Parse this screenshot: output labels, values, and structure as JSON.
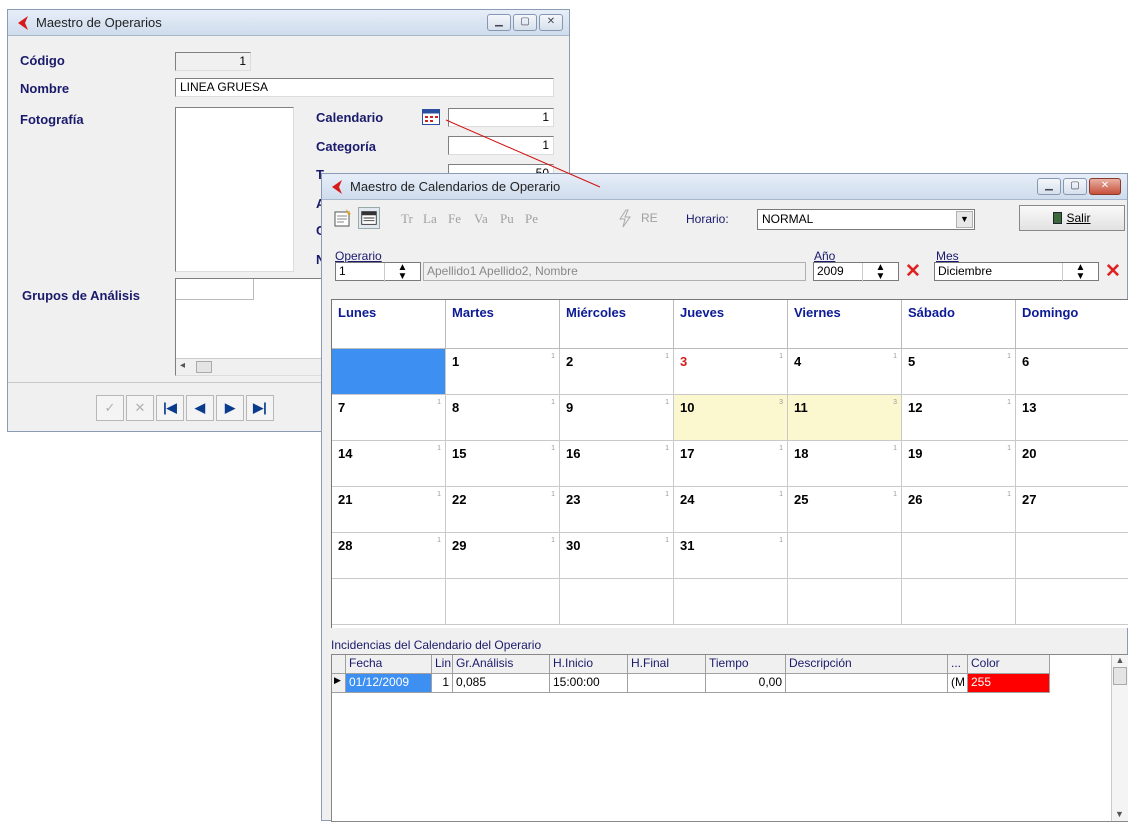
{
  "operarios": {
    "title": "Maestro de Operarios",
    "labels": {
      "codigo": "Código",
      "nombre": "Nombre",
      "fotografia": "Fotografía",
      "calendario": "Calendario",
      "categoria": "Categoría",
      "tarifa": "T",
      "a": "A",
      "c": "C",
      "n": "N",
      "grupos": "Grupos de Análisis"
    },
    "values": {
      "codigo": "1",
      "nombre": "LINEA GRUESA",
      "calendario": "1",
      "categoria": "1",
      "tarifa_partial": "50"
    },
    "nav": [
      "✓",
      "✕",
      "|◀",
      "◀",
      "▶",
      "▶|"
    ]
  },
  "calendarios": {
    "title": "Maestro de Calendarios de Operario",
    "toolbar": {
      "day_codes": [
        "Tr",
        "La",
        "Fe",
        "Va",
        "Pu",
        "Pe"
      ],
      "re": "RE",
      "horario_label": "Horario:",
      "horario_value": "NORMAL",
      "salir_label": "Salir"
    },
    "filters": {
      "operario_label": "Operario",
      "operario_value": "1",
      "operario_name_placeholder": "Apellido1 Apellido2, Nombre",
      "anio_label": "Año",
      "anio_value": "2009",
      "mes_label": "Mes",
      "mes_value": "Diciembre"
    },
    "calendar": {
      "weekdays": [
        "Lunes",
        "Martes",
        "Miércoles",
        "Jueves",
        "Viernes",
        "Sábado",
        "Domingo"
      ],
      "weeks": [
        [
          {
            "d": "",
            "m": "",
            "s": "sel"
          },
          {
            "d": "1",
            "m": "1"
          },
          {
            "d": "2",
            "m": "1"
          },
          {
            "d": "3",
            "m": "1",
            "s": "red"
          },
          {
            "d": "4",
            "m": "1"
          },
          {
            "d": "5",
            "m": "1"
          },
          {
            "d": "6",
            "m": ""
          }
        ],
        [
          {
            "d": "7",
            "m": "1"
          },
          {
            "d": "8",
            "m": "1"
          },
          {
            "d": "9",
            "m": "1"
          },
          {
            "d": "10",
            "m": "3",
            "s": "hl"
          },
          {
            "d": "11",
            "m": "3",
            "s": "hl"
          },
          {
            "d": "12",
            "m": "1"
          },
          {
            "d": "13",
            "m": ""
          }
        ],
        [
          {
            "d": "14",
            "m": "1"
          },
          {
            "d": "15",
            "m": "1"
          },
          {
            "d": "16",
            "m": "1"
          },
          {
            "d": "17",
            "m": "1"
          },
          {
            "d": "18",
            "m": "1"
          },
          {
            "d": "19",
            "m": "1"
          },
          {
            "d": "20",
            "m": ""
          }
        ],
        [
          {
            "d": "21",
            "m": "1"
          },
          {
            "d": "22",
            "m": "1"
          },
          {
            "d": "23",
            "m": "1"
          },
          {
            "d": "24",
            "m": "1"
          },
          {
            "d": "25",
            "m": "1"
          },
          {
            "d": "26",
            "m": "1"
          },
          {
            "d": "27",
            "m": ""
          }
        ],
        [
          {
            "d": "28",
            "m": "1"
          },
          {
            "d": "29",
            "m": "1"
          },
          {
            "d": "30",
            "m": "1"
          },
          {
            "d": "31",
            "m": "1"
          },
          {
            "d": "",
            "m": ""
          },
          {
            "d": "",
            "m": ""
          },
          {
            "d": "",
            "m": ""
          }
        ],
        [
          {
            "d": "",
            "m": ""
          },
          {
            "d": "",
            "m": ""
          },
          {
            "d": "",
            "m": ""
          },
          {
            "d": "",
            "m": ""
          },
          {
            "d": "",
            "m": ""
          },
          {
            "d": "",
            "m": ""
          },
          {
            "d": "",
            "m": ""
          }
        ]
      ]
    },
    "incidencias": {
      "title": "Incidencias del Calendario del Operario",
      "columns": [
        "Fecha",
        "Lin",
        "Gr.Análisis",
        "H.Inicio",
        "H.Final",
        "Tiempo",
        "Descripción",
        "...",
        "Color"
      ],
      "rows": [
        [
          "01/12/2009",
          "1",
          "0,085",
          "15:00:00",
          "",
          "0,00",
          "",
          "(M",
          "255"
        ]
      ]
    },
    "colors": {
      "selected_cell": "#3d8ff1",
      "highlight_cell": "#fbf7cf",
      "holiday_text": "#d41f1f",
      "color_cell": "#ff0000"
    }
  }
}
